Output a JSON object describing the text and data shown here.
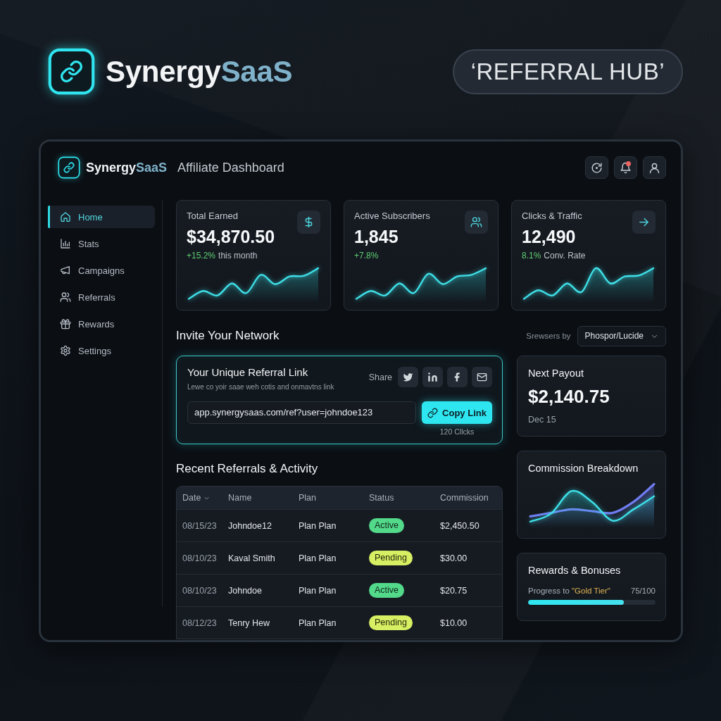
{
  "hero": {
    "brand": {
      "name": "Synergy",
      "accent": "SaaS"
    },
    "badge": "‘REFERRAL HUB’"
  },
  "header": {
    "brand": {
      "name": "Synergy",
      "accent": "SaaS"
    },
    "title": "Affiliate Dashboard",
    "notifications_unread": true
  },
  "sidebar": {
    "items": [
      {
        "label": "Home",
        "kind": "home",
        "selected": true
      },
      {
        "label": "Stats",
        "kind": "stats",
        "selected": false
      },
      {
        "label": "Campaigns",
        "kind": "campaigns",
        "selected": false
      },
      {
        "label": "Referrals",
        "kind": "referrals",
        "selected": false
      },
      {
        "label": "Rewards",
        "kind": "rewards",
        "selected": false
      },
      {
        "label": "Settings",
        "kind": "settings",
        "selected": false
      }
    ]
  },
  "stats": [
    {
      "label": "Total Earned",
      "value": "$34,870.50",
      "change": "+15.2%",
      "note": "this month",
      "kind": "dollar"
    },
    {
      "label": "Active Subscribers",
      "value": "1,845",
      "change": "+7.8%",
      "kind": "users"
    },
    {
      "label": "Clicks & Traffic",
      "value": "12,490",
      "change": "8.1%",
      "note": "Conv. Rate",
      "kind": "arrow"
    }
  ],
  "invite": {
    "title": "Invite Your Network",
    "filter": {
      "label": "Srewsers by",
      "value": "Phospor/Lucide"
    },
    "referral_link": {
      "title": "Your Unique Referral Link",
      "subtitle": "Lewe co yoir saae weh cotis and onmavtns link",
      "share_label": "Share",
      "share_buttons": [
        {
          "kind": "twitter"
        },
        {
          "kind": "linkedin"
        },
        {
          "kind": "facebook"
        },
        {
          "kind": "email"
        }
      ],
      "link": "app.synergysaas.com/ref?user=johndoe123",
      "button": "Copy Link",
      "clicks": "120 Cllcks"
    }
  },
  "payout": {
    "title": "Next Payout",
    "amount": "$2,140.75",
    "date": "Dec 15"
  },
  "commission_breakdown": {
    "title": "Commission Breakdown"
  },
  "rewards": {
    "title": "Rewards & Bonuses",
    "progress_label": "Progress to",
    "tier": "\"Gold Tier\"",
    "reading": "75/100",
    "level": 0.75
  },
  "activity": {
    "title": "Recent Referrals & Activity",
    "columns": [
      {
        "label": "Date",
        "sorted": true
      },
      {
        "label": "Name",
        "sorted": false
      },
      {
        "label": "Plan",
        "sorted": false
      },
      {
        "label": "Status",
        "sorted": false
      },
      {
        "label": "Commission",
        "sorted": false
      }
    ],
    "rows": [
      {
        "date": "08/15/23",
        "name": "Johndoe12",
        "plan": "Plan Plan",
        "status": {
          "label": "Active",
          "kind": "active"
        },
        "commission": "$2,450.50"
      },
      {
        "date": "08/10/23",
        "name": "Kaval Smith",
        "plan": "Plan Plan",
        "status": {
          "label": "Pending",
          "kind": "pending"
        },
        "commission": "$30.00"
      },
      {
        "date": "08/10/23",
        "name": "Johndoe",
        "plan": "Plan Plan",
        "status": {
          "label": "Active",
          "kind": "active"
        },
        "commission": "$20.75"
      },
      {
        "date": "08/12/23",
        "name": "Tenry Hew",
        "plan": "Plan Plan",
        "status": {
          "label": "Pending",
          "kind": "pending"
        },
        "commission": "$10.00"
      }
    ]
  }
}
